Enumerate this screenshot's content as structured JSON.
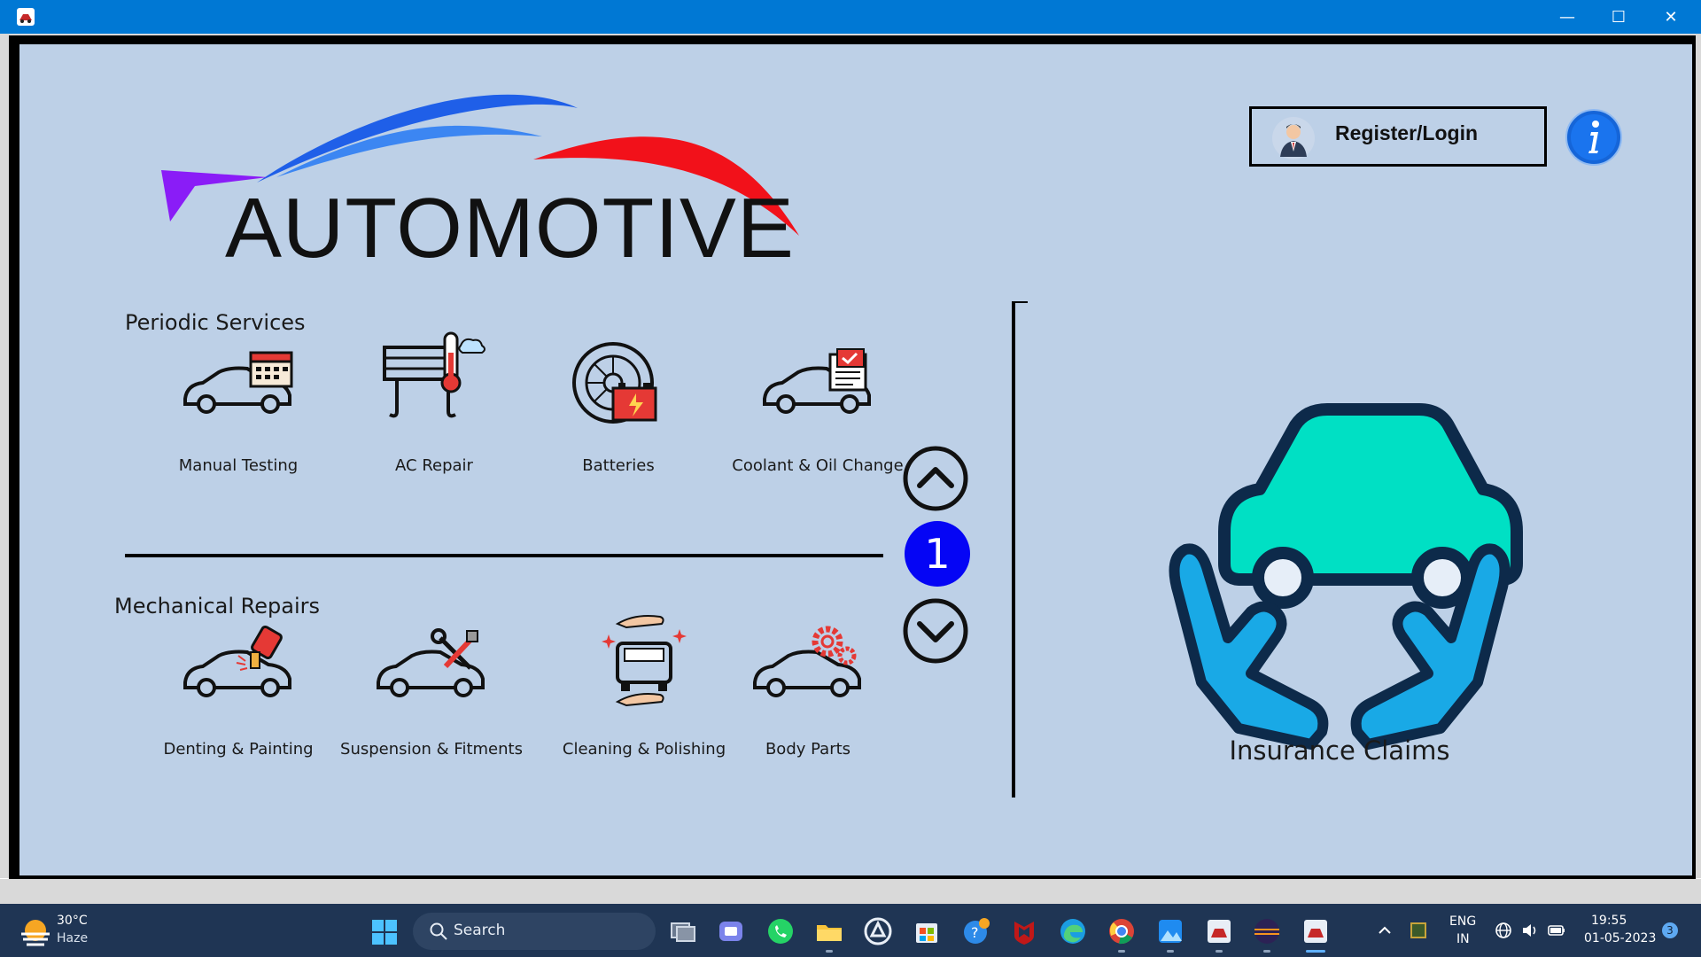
{
  "window": {
    "minimize_glyph": "—",
    "maximize_glyph": "☐",
    "close_glyph": "✕"
  },
  "header": {
    "logo_text": "AUTOMOTIVE",
    "login_label": "Register/Login",
    "info_icon": "info-icon"
  },
  "periodic": {
    "title": "Periodic Services",
    "items": [
      {
        "label": "Manual Testing",
        "icon": "car-calendar-icon"
      },
      {
        "label": "AC Repair",
        "icon": "ac-thermometer-icon"
      },
      {
        "label": "Batteries",
        "icon": "tyre-battery-icon"
      },
      {
        "label": "Coolant & Oil Change",
        "icon": "car-document-icon"
      }
    ]
  },
  "mechanical": {
    "title": "Mechanical Repairs",
    "items": [
      {
        "label": "Denting & Painting",
        "icon": "car-paint-icon"
      },
      {
        "label": "Suspension & Fitments",
        "icon": "car-wrench-icon"
      },
      {
        "label": "Cleaning & Polishing",
        "icon": "car-wash-hands-icon"
      },
      {
        "label": "Body Parts",
        "icon": "car-gears-icon"
      }
    ]
  },
  "pager": {
    "current_page": "1",
    "up_icon": "chevron-up-icon",
    "down_icon": "chevron-down-icon"
  },
  "insurance": {
    "label": "Insurance Claims",
    "icon": "car-hands-icon"
  },
  "taskbar": {
    "weather_temp": "30°C",
    "weather_condition": "Haze",
    "search_placeholder": "Search",
    "language_top": "ENG",
    "language_bottom": "IN",
    "time": "19:55",
    "date": "01-05-2023",
    "notification_count": "3"
  },
  "colors": {
    "background": "#bdd0e7",
    "titlebar": "#0078d4",
    "page_badge": "#0505f5",
    "insurance_car": "#00e0c4",
    "insurance_hands": "#19a9e6",
    "taskbar": "#1f3554"
  }
}
